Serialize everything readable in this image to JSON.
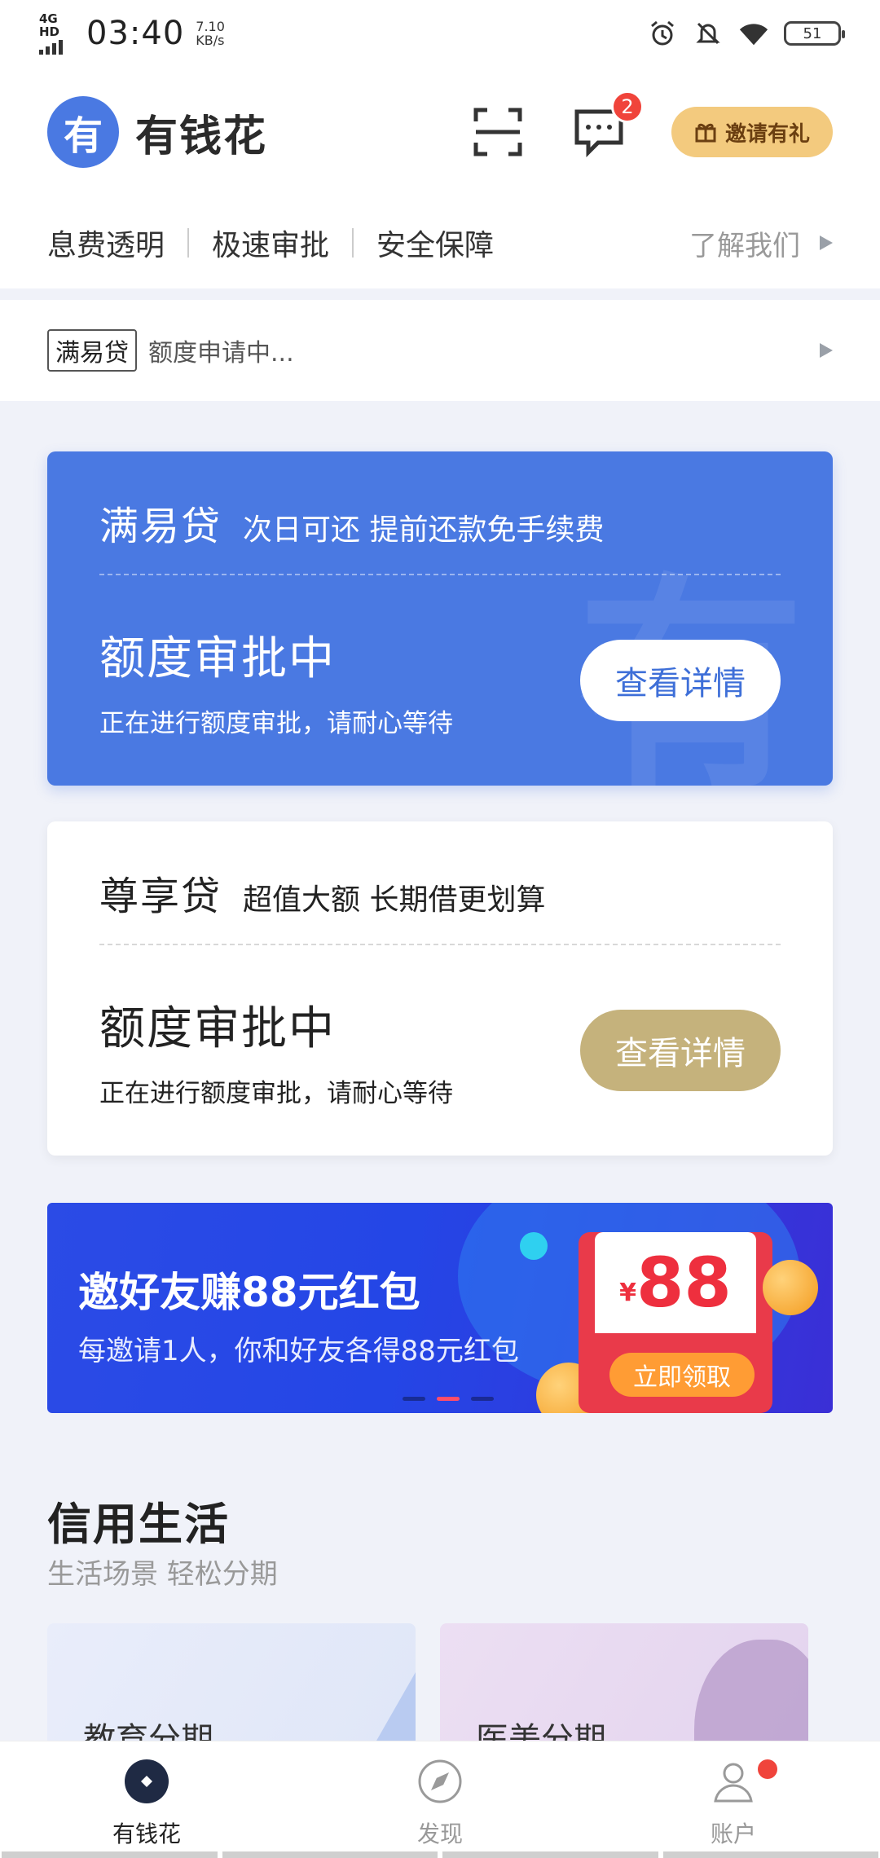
{
  "status_bar": {
    "network": "4G HD",
    "time": "03:40",
    "speed_value": "7.10",
    "speed_unit": "KB/s",
    "battery": "51"
  },
  "header": {
    "logo_glyph": "有",
    "app_name": "有钱花",
    "message_badge": "2",
    "invite_label": "邀请有礼"
  },
  "features": {
    "items": [
      "息费透明",
      "极速审批",
      "安全保障"
    ],
    "about_label": "了解我们"
  },
  "notice": {
    "tag": "满易贷",
    "text": "额度申请中..."
  },
  "cards": [
    {
      "title": "满易贷",
      "slogan": "次日可还 提前还款免手续费",
      "status": "额度审批中",
      "subtext": "正在进行额度审批，请耐心等待",
      "button": "查看详情"
    },
    {
      "title": "尊享贷",
      "slogan": "超值大额 长期借更划算",
      "status": "额度审批中",
      "subtext": "正在进行额度审批，请耐心等待",
      "button": "查看详情"
    }
  ],
  "banner": {
    "title": "邀好友赚88元红包",
    "subtitle": "每邀请1人，你和好友各得88元红包",
    "currency": "¥",
    "amount": "88",
    "cta": "立即领取",
    "active_dot": 1
  },
  "credit_life": {
    "title": "信用生活",
    "subtitle": "生活场景 轻松分期",
    "tiles": [
      "教育分期",
      "医美分期"
    ]
  },
  "bottom_nav": {
    "items": [
      {
        "label": "有钱花",
        "icon": "home-diamond-icon",
        "active": true
      },
      {
        "label": "发现",
        "icon": "compass-icon",
        "active": false
      },
      {
        "label": "账户",
        "icon": "user-icon",
        "active": false
      }
    ]
  },
  "colors": {
    "brand_blue": "#4a79e2",
    "gold": "#c5b27c",
    "invite_bg": "#f3ca7e",
    "badge_red": "#f0443b"
  }
}
